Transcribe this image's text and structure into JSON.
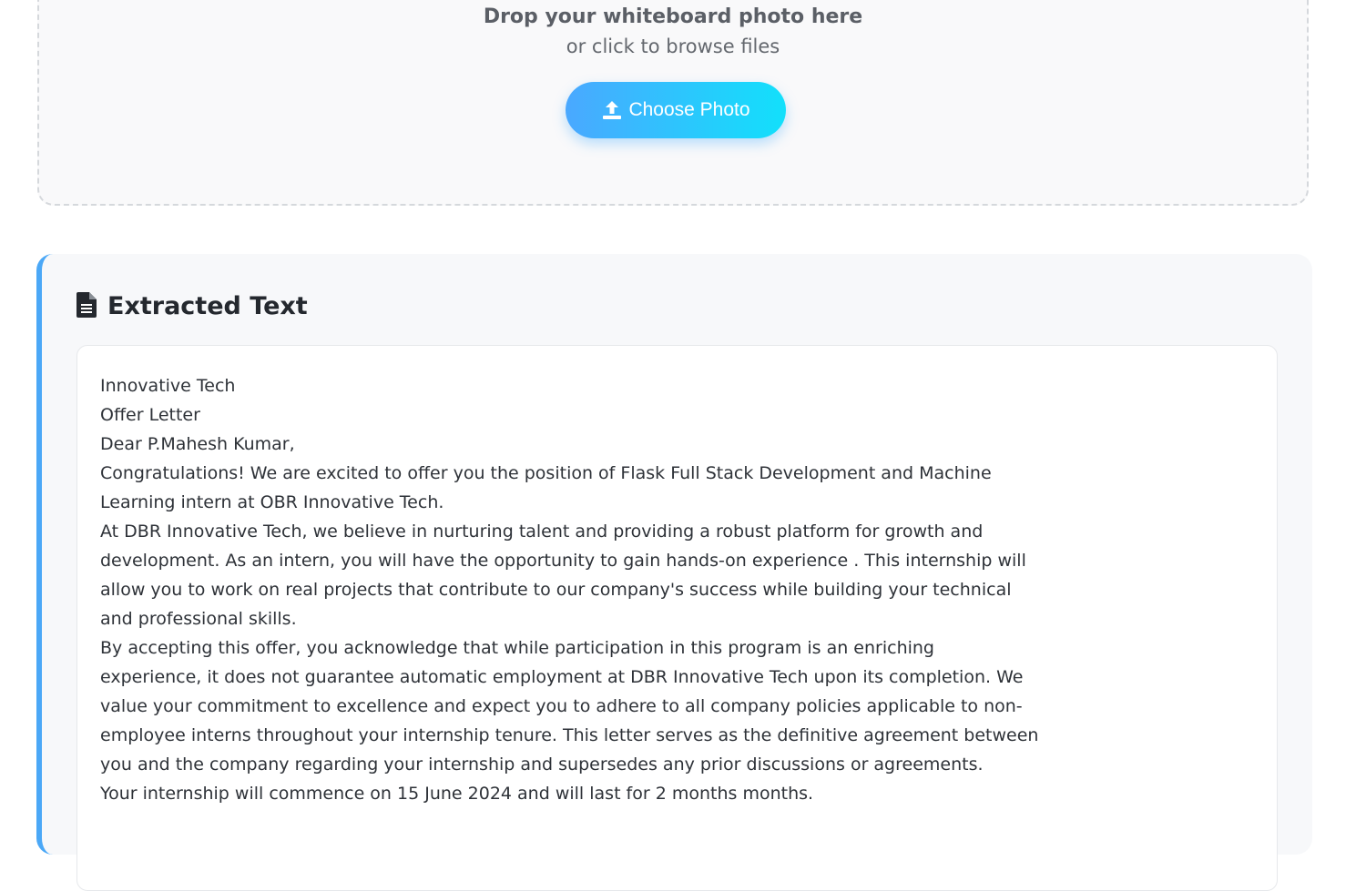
{
  "upload": {
    "title": "Drop your whiteboard photo here",
    "subtitle": "or click to browse files",
    "button_label": "Choose Photo",
    "button_icon": "upload-icon"
  },
  "extracted": {
    "heading": "Extracted Text",
    "heading_icon": "file-text-icon",
    "lines": [
      "Innovative Tech",
      "Offer Letter",
      "Dear P.Mahesh Kumar,",
      "Congratulations! We are excited to offer you the position of Flask Full Stack Development and Machine",
      "Learning intern at OBR Innovative Tech.",
      "At DBR Innovative Tech, we believe in nurturing talent and providing a robust platform for growth and",
      "development. As an intern, you will have the opportunity to gain hands-on experience . This internship will",
      "allow you to work on real projects that contribute to our company's success while building your technical",
      "and professional skills.",
      "By accepting this offer, you acknowledge that while participation in this program is an enriching",
      "experience, it does not guarantee automatic employment at DBR Innovative Tech upon its completion. We",
      "value your commitment to excellence and expect you to adhere to all company policies applicable to non-",
      "employee interns throughout your internship tenure. This letter serves as the definitive agreement between",
      "you and the company regarding your internship and supersedes any prior discussions or agreements.",
      "Your internship will commence on 15 June 2024 and will last for 2 months months."
    ]
  },
  "colors": {
    "accent": "#4ba8f7",
    "button_gradient_start": "#4aa8ff",
    "button_gradient_end": "#12e0fb"
  }
}
